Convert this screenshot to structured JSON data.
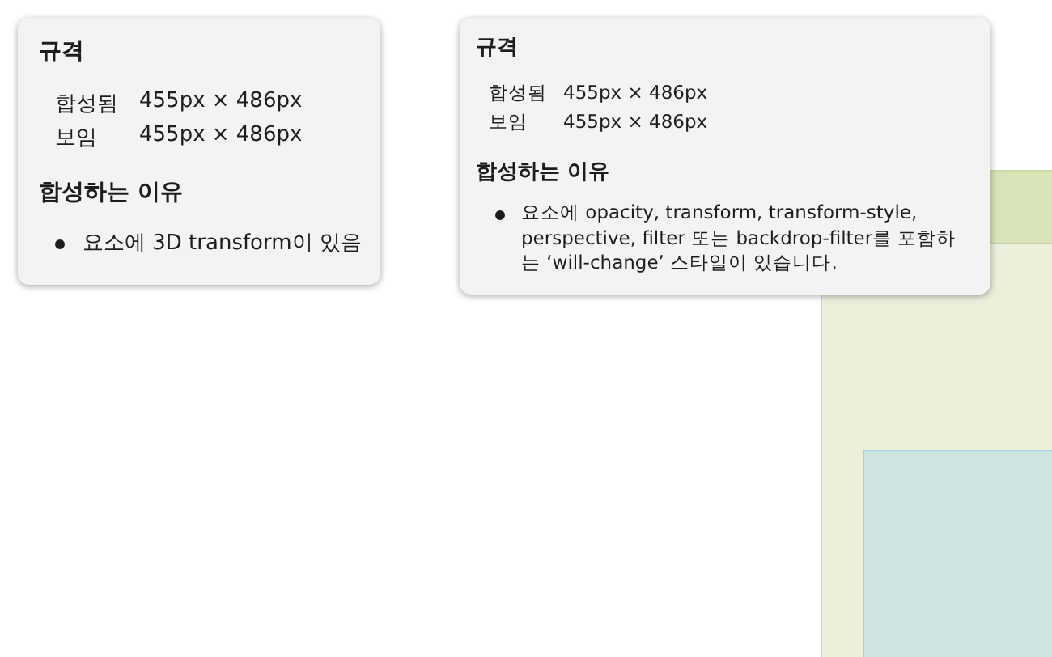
{
  "popups": [
    {
      "spec_title": "규격",
      "rows": [
        {
          "label": "합성됨",
          "value": "455px × 486px"
        },
        {
          "label": "보임",
          "value": "455px × 486px"
        }
      ],
      "reasons_title": "합성하는 이유",
      "reasons": [
        "요소에 3D transform이 있음"
      ]
    },
    {
      "spec_title": "규격",
      "rows": [
        {
          "label": "합성됨",
          "value": "455px × 486px"
        },
        {
          "label": "보임",
          "value": "455px × 486px"
        }
      ],
      "reasons_title": "합성하는 이유",
      "reasons": [
        "요소에 opacity, transform, transform-style, perspective, filter 또는 backdrop-filter를 포함하는 ‘will-change’ 스타일이 있습니다."
      ]
    }
  ]
}
